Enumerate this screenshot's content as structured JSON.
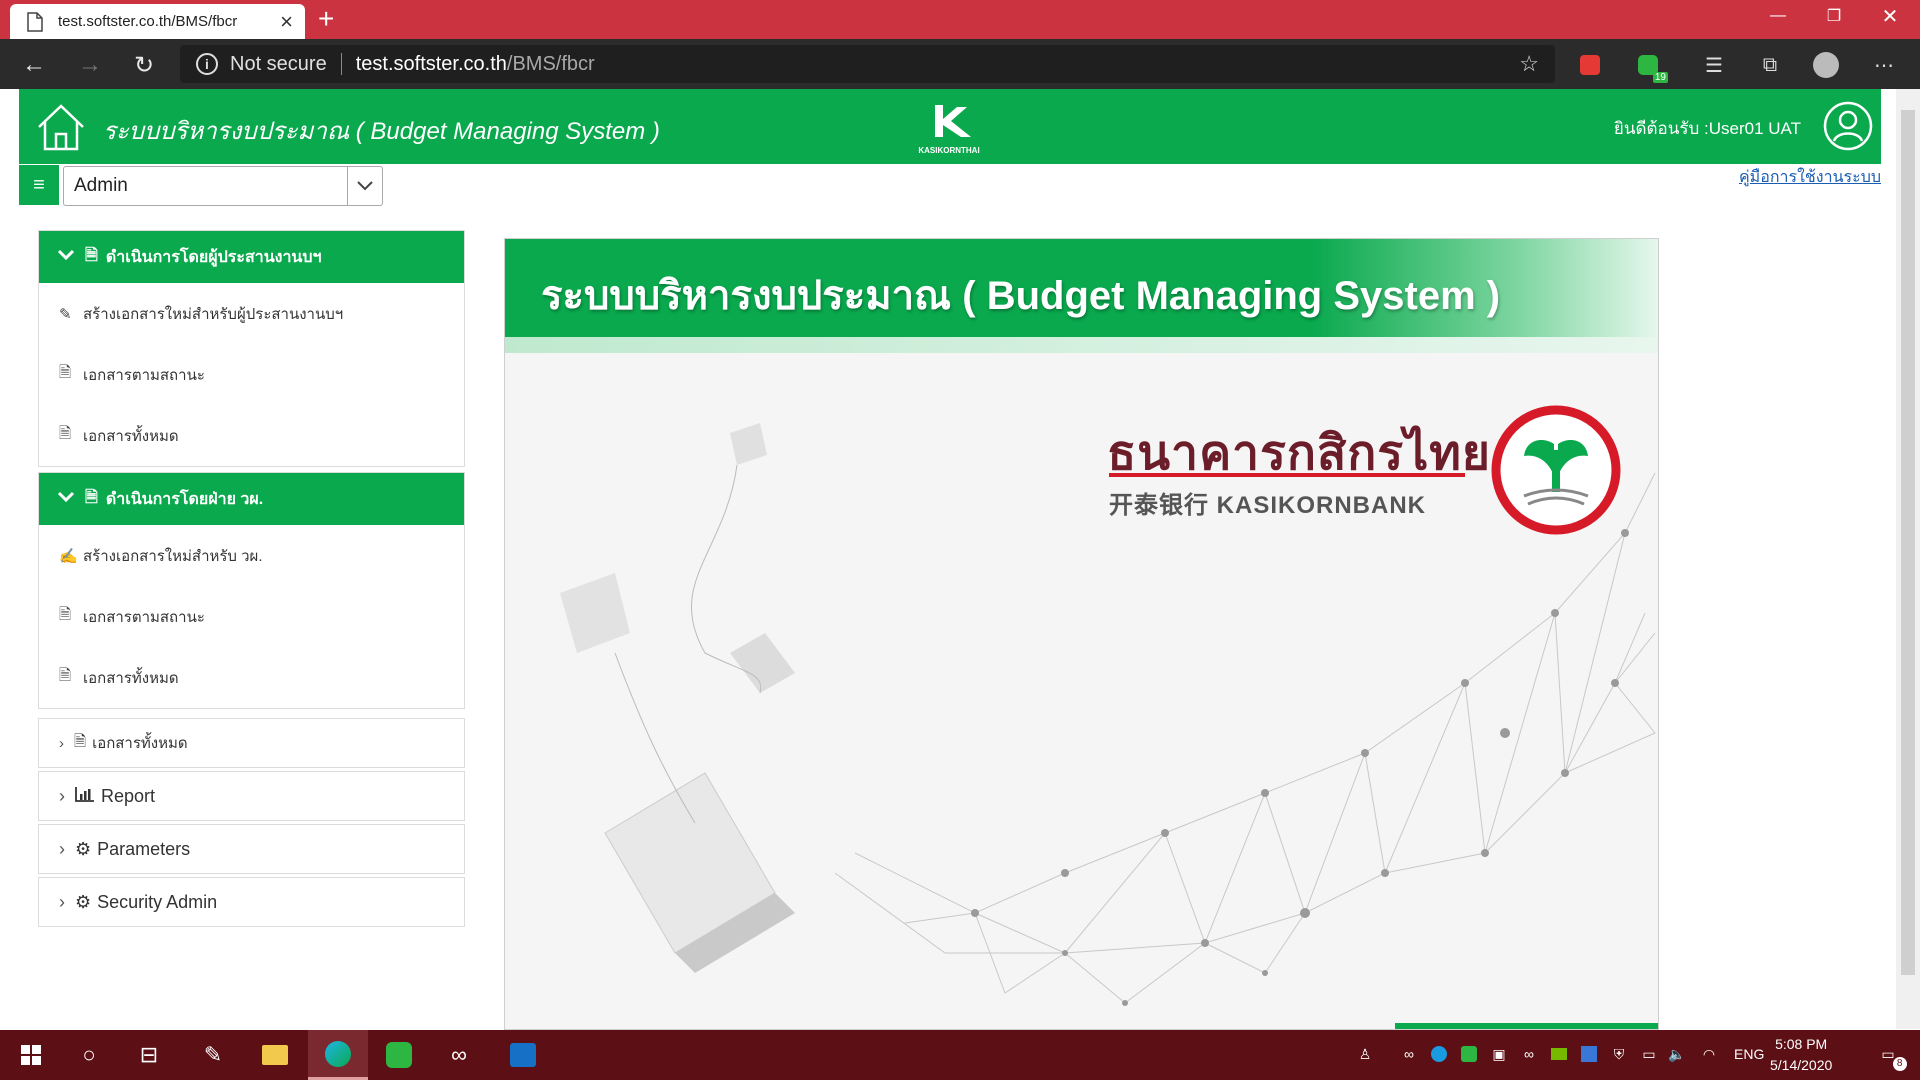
{
  "browser": {
    "tab_title": "test.softster.co.th/BMS/fbcr",
    "not_secure": "Not secure",
    "url_host": "test.softster.co.th",
    "url_path": "/BMS/fbcr",
    "notification_count": "19"
  },
  "header": {
    "app_title": "ระบบบริหารงบประมาณ ( Budget Managing System )",
    "logo_text": "KASIKORNTHAI",
    "welcome": "ยินดีต้อนรับ :User01 UAT",
    "role_value": "Admin",
    "manual_link": "คู่มือการใช้งานระบบ"
  },
  "sidebar": {
    "group1": {
      "title": "ดำเนินการโดยผู้ประสานงานบฯ",
      "items": [
        {
          "label": "สร้างเอกสารใหม่สำหรับผู้ประสานงานบฯ",
          "icon": "pencil-icon"
        },
        {
          "label": "เอกสารตามสถานะ",
          "icon": "document-icon"
        },
        {
          "label": "เอกสารทั้งหมด",
          "icon": "document-icon"
        }
      ]
    },
    "group2": {
      "title": "ดำเนินการโดยฝ่าย วผ.",
      "items": [
        {
          "label": "สร้างเอกสารใหม่สำหรับ วผ.",
          "icon": "edit-icon"
        },
        {
          "label": "เอกสารตามสถานะ",
          "icon": "document-icon"
        },
        {
          "label": "เอกสารทั้งหมด",
          "icon": "document-icon"
        }
      ]
    },
    "collapsed": [
      {
        "label": "เอกสารทั้งหมด",
        "icon": "document-icon"
      },
      {
        "label": "Report",
        "icon": "bar-chart-icon"
      },
      {
        "label": "Parameters",
        "icon": "cogs-icon"
      },
      {
        "label": "Security Admin",
        "icon": "gear-icon"
      }
    ]
  },
  "banner": {
    "title": "ระบบบริหารงบประมาณ ( Budget Managing System )",
    "bank_name_th": "ธนาคารกสิกรไทย",
    "bank_name_en": "开泰银行 KASIKORNBANK"
  },
  "taskbar": {
    "language": "ENG",
    "time": "5:08 PM",
    "date": "5/14/2020",
    "notifications": "8"
  },
  "colors": {
    "brand_green": "#0aa94e",
    "tab_red": "#cc3340",
    "taskbar": "#5c0f14"
  }
}
